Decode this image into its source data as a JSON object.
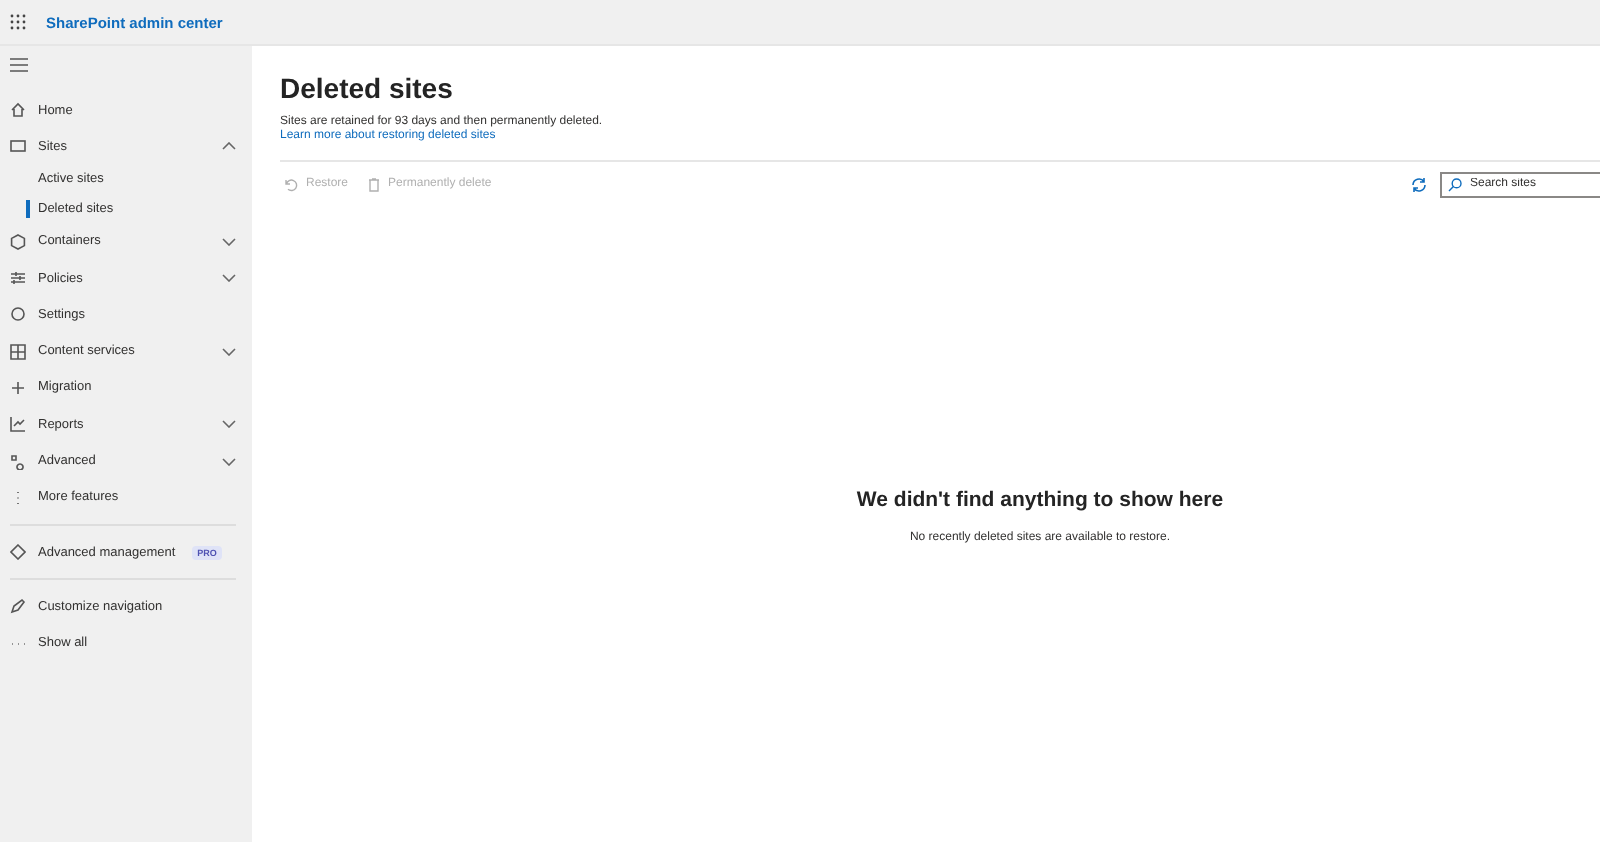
{
  "app_bar": {
    "title": "SharePoint admin center"
  },
  "nav": [
    {
      "kind": "link",
      "label": "Home"
    },
    {
      "kind": "group",
      "label": "Sites",
      "expanded": true
    },
    {
      "kind": "sub",
      "label": "Active sites",
      "selected": false
    },
    {
      "kind": "sub",
      "label": "Deleted sites",
      "selected": true
    },
    {
      "kind": "group",
      "label": "Containers",
      "expanded": false
    },
    {
      "kind": "group",
      "label": "Policies",
      "expanded": false
    },
    {
      "kind": "link",
      "label": "Settings"
    },
    {
      "kind": "group",
      "label": "Content services",
      "expanded": false
    },
    {
      "kind": "link",
      "label": "Migration"
    },
    {
      "kind": "group",
      "label": "Reports",
      "expanded": false
    },
    {
      "kind": "group",
      "label": "Advanced",
      "expanded": false
    },
    {
      "kind": "link",
      "label": "More features"
    },
    {
      "kind": "divider"
    },
    {
      "kind": "link",
      "label": "Advanced management",
      "badge": "PRO"
    },
    {
      "kind": "divider"
    },
    {
      "kind": "link",
      "label": "Customize navigation"
    },
    {
      "kind": "link",
      "label": "Show all"
    }
  ],
  "page": {
    "title": "Deleted sites",
    "description": "Sites are retained for 93 days and then permanently deleted.",
    "link": "Learn more about restoring deleted sites"
  },
  "toolbar": {
    "actions": [
      {
        "label": "Restore",
        "disabled": true
      },
      {
        "label": "Permanently delete",
        "disabled": true
      }
    ],
    "search": {
      "placeholder": "Search sites"
    }
  },
  "empty_state": {
    "title": "We didn't find anything to show here",
    "message": "No recently deleted sites are available to restore."
  }
}
